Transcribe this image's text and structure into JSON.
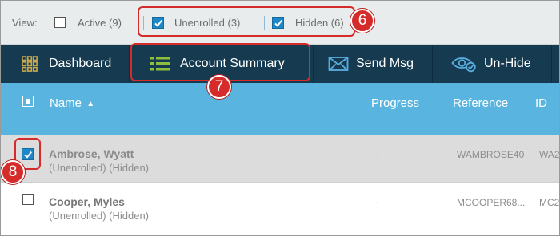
{
  "filter_bar": {
    "view_label": "View:",
    "options": [
      {
        "label": "Active (9)",
        "checked": false
      },
      {
        "label": "Unenrolled (3)",
        "checked": true
      },
      {
        "label": "Hidden (6)",
        "checked": true
      }
    ],
    "separator": "|"
  },
  "toolbar": {
    "items": [
      {
        "label": "Dashboard",
        "icon": "grid-icon"
      },
      {
        "label": "Account Summary",
        "icon": "list-icon"
      },
      {
        "label": "Send Msg",
        "icon": "envelope-icon"
      },
      {
        "label": "Un-Hide",
        "icon": "eye-icon"
      }
    ]
  },
  "table": {
    "columns": {
      "name": "Name",
      "progress": "Progress",
      "reference": "Reference",
      "id": "ID"
    },
    "sort_indicator": "▲",
    "rows": [
      {
        "name": "Ambrose, Wyatt",
        "status": "(Unenrolled) (Hidden)",
        "progress": "-",
        "reference": "WAMBROSE40",
        "id": "WA2",
        "selected": true
      },
      {
        "name": "Cooper, Myles",
        "status": "(Unenrolled) (Hidden)",
        "progress": "-",
        "reference": "MCOOPER68...",
        "id": "MC2",
        "selected": false
      }
    ]
  },
  "callouts": [
    "6",
    "7",
    "8"
  ],
  "colors": {
    "toolbar_bg": "#163a4f",
    "header_bg": "#5ab4e0",
    "accent_checkbox": "#1e87c7",
    "callout": "#d62b2b",
    "icon_green": "#8fbd3c",
    "icon_gold": "#c7a84a",
    "icon_blue": "#59aee0"
  }
}
